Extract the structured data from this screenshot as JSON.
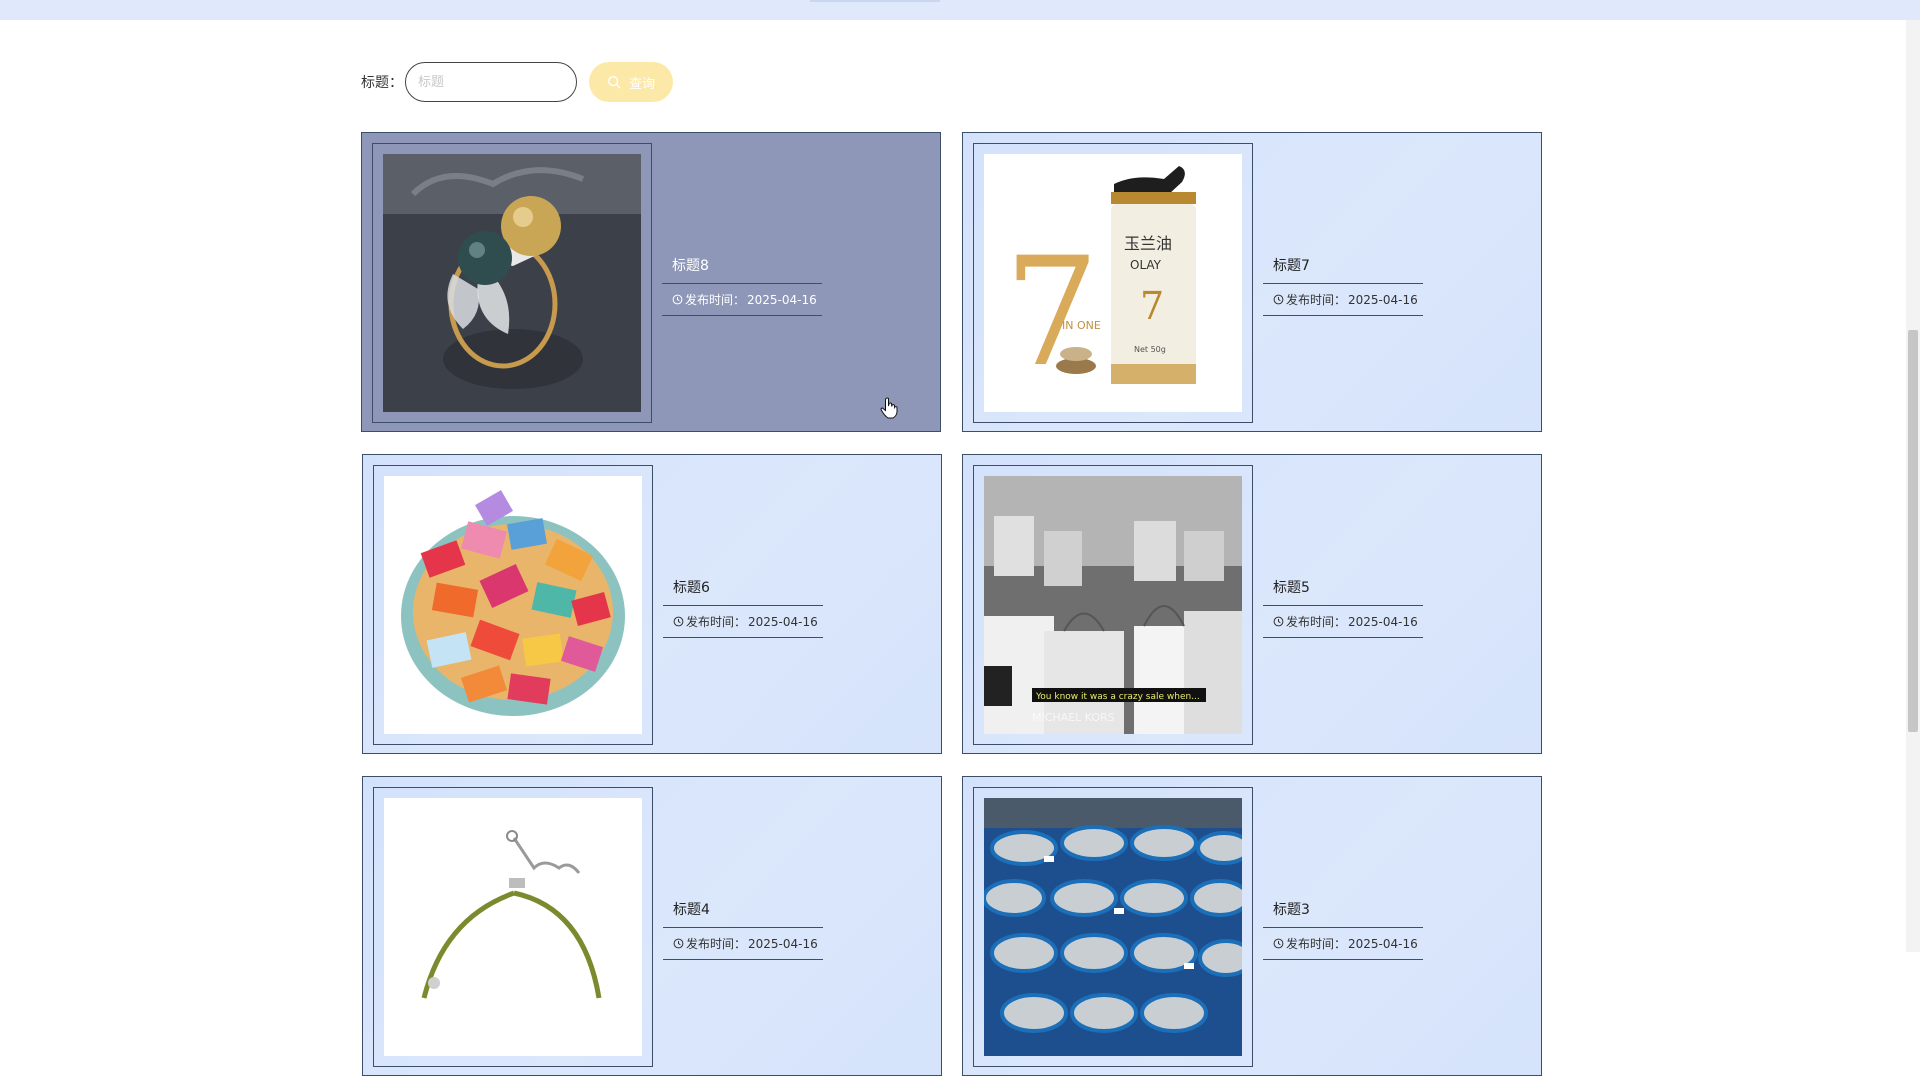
{
  "search": {
    "label": "标题：",
    "placeholder": "标题",
    "value": "",
    "button_label": "查询"
  },
  "cards": [
    {
      "title": "标题8",
      "date_label": "发布时间：",
      "date": "2025-04-16",
      "image": "pearl-ring-photo",
      "hovered": true
    },
    {
      "title": "标题7",
      "date_label": "发布时间：",
      "date": "2025-04-16",
      "image": "olay-cream-photo",
      "hovered": false
    },
    {
      "title": "标题6",
      "date_label": "发布时间：",
      "date": "2025-04-16",
      "image": "candy-plate-photo",
      "hovered": false
    },
    {
      "title": "标题5",
      "date_label": "发布时间：",
      "date": "2025-04-16",
      "image": "shopping-bags-photo",
      "hovered": false
    },
    {
      "title": "标题4",
      "date_label": "发布时间：",
      "date": "2025-04-16",
      "image": "bracelet-photo",
      "hovered": false
    },
    {
      "title": "标题3",
      "date_label": "发布时间：",
      "date": "2025-04-16",
      "image": "fish-tray-photo",
      "hovered": false
    }
  ],
  "photo_texts": {
    "olay_brand_cn": "玉兰油",
    "olay_brand": "OLAY",
    "olay_number": "7",
    "olay_in_one": "IN ONE",
    "olay_weight": "Net 50g",
    "bags_caption": "You know it was a crazy sale when...",
    "bags_brand": "MICHAEL KORS"
  },
  "colors": {
    "card_bg": "#d6e4fb",
    "card_hover_bg": "#8e97b8",
    "border": "#3d4e6b",
    "search_button": "#fde9a7",
    "topbar": "#dfe9fb"
  }
}
